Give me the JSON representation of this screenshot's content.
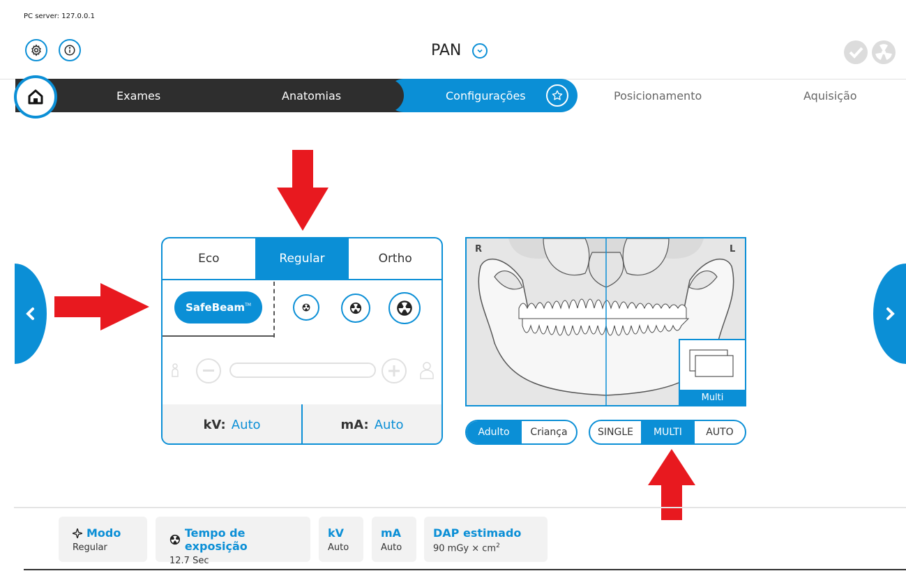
{
  "server": {
    "label": "PC server: 127.0.0.1"
  },
  "header": {
    "title": "PAN",
    "settings_icon": "gear-icon",
    "info_icon": "info-icon",
    "status_icons": [
      "check-icon",
      "radiation-icon"
    ]
  },
  "nav": {
    "items": [
      {
        "label": "Exames",
        "state": "completed"
      },
      {
        "label": "Anatomias",
        "state": "completed"
      },
      {
        "label": "Configurações",
        "state": "active"
      },
      {
        "label": "Posicionamento",
        "state": "pending"
      },
      {
        "label": "Aquisição",
        "state": "pending"
      }
    ]
  },
  "mode_panel": {
    "tabs": [
      {
        "label": "Eco",
        "active": false
      },
      {
        "label": "Regular",
        "active": true
      },
      {
        "label": "Ortho",
        "active": false
      }
    ],
    "safebeam_label": "SafeBeam",
    "safebeam_tm": "TM",
    "kv_label": "kV:",
    "kv_value": "Auto",
    "ma_label": "mA:",
    "ma_value": "Auto"
  },
  "xray": {
    "left_label": "R",
    "right_label": "L",
    "multi_label": "Multi"
  },
  "patient_toggle": [
    {
      "label": "Adulto",
      "active": true
    },
    {
      "label": "Criança",
      "active": false
    }
  ],
  "image_mode_toggle": [
    {
      "label": "SINGLE",
      "active": false
    },
    {
      "label": "MULTI",
      "active": true
    },
    {
      "label": "AUTO",
      "active": false
    }
  ],
  "summary": {
    "modo": {
      "title": "Modo",
      "value": "Regular"
    },
    "tempo": {
      "title": "Tempo de exposição",
      "value": "12.7 Sec"
    },
    "kv": {
      "title": "kV",
      "value": "Auto"
    },
    "ma": {
      "title": "mA",
      "value": "Auto"
    },
    "dap": {
      "title": "DAP estimado",
      "value": "90 mGy × cm",
      "sup": "2"
    }
  },
  "colors": {
    "accent": "#0b8fd6",
    "dark": "#2e2e2e",
    "annotation": "#e8191f"
  }
}
